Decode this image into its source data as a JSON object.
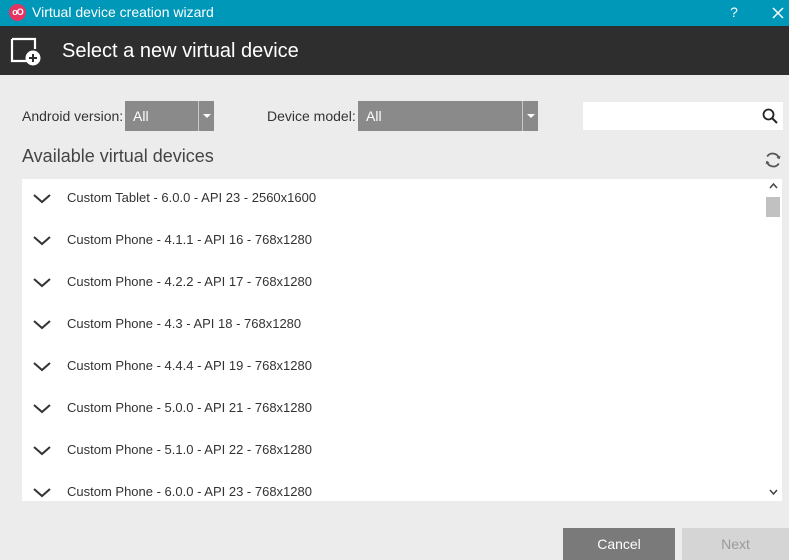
{
  "window": {
    "title": "Virtual device creation wizard",
    "app_icon_text": "oO",
    "help_label": "?"
  },
  "header": {
    "title": "Select a new virtual device"
  },
  "filters": {
    "android_version_label": "Android version:",
    "android_version_value": "All",
    "device_model_label": "Device model:",
    "device_model_value": "All",
    "search_value": "",
    "search_placeholder": ""
  },
  "section": {
    "title": "Available virtual devices"
  },
  "devices": [
    {
      "label": "Custom Tablet - 6.0.0 - API 23 - 2560x1600"
    },
    {
      "label": "Custom Phone - 4.1.1 - API 16 - 768x1280"
    },
    {
      "label": "Custom Phone - 4.2.2 - API 17 - 768x1280"
    },
    {
      "label": "Custom Phone - 4.3 - API 18 - 768x1280"
    },
    {
      "label": "Custom Phone - 4.4.4 - API 19 - 768x1280"
    },
    {
      "label": "Custom Phone - 5.0.0 - API 21 - 768x1280"
    },
    {
      "label": "Custom Phone - 5.1.0 - API 22 - 768x1280"
    },
    {
      "label": "Custom Phone - 6.0.0 - API 23 - 768x1280"
    }
  ],
  "buttons": {
    "cancel": "Cancel",
    "next": "Next"
  },
  "colors": {
    "titlebar": "#0098b8",
    "header": "#2e2e2e",
    "app_icon": "#e63462",
    "dropdown": "#8a8a8a",
    "cancel_button": "#7a7a7a",
    "next_button_disabled": "#d5d5d5"
  },
  "icons": {
    "app": "genymotion-logo-icon",
    "header": "add-device-icon",
    "search": "search-icon",
    "refresh": "refresh-icon",
    "expand": "chevron-down-icon",
    "close": "close-icon"
  }
}
